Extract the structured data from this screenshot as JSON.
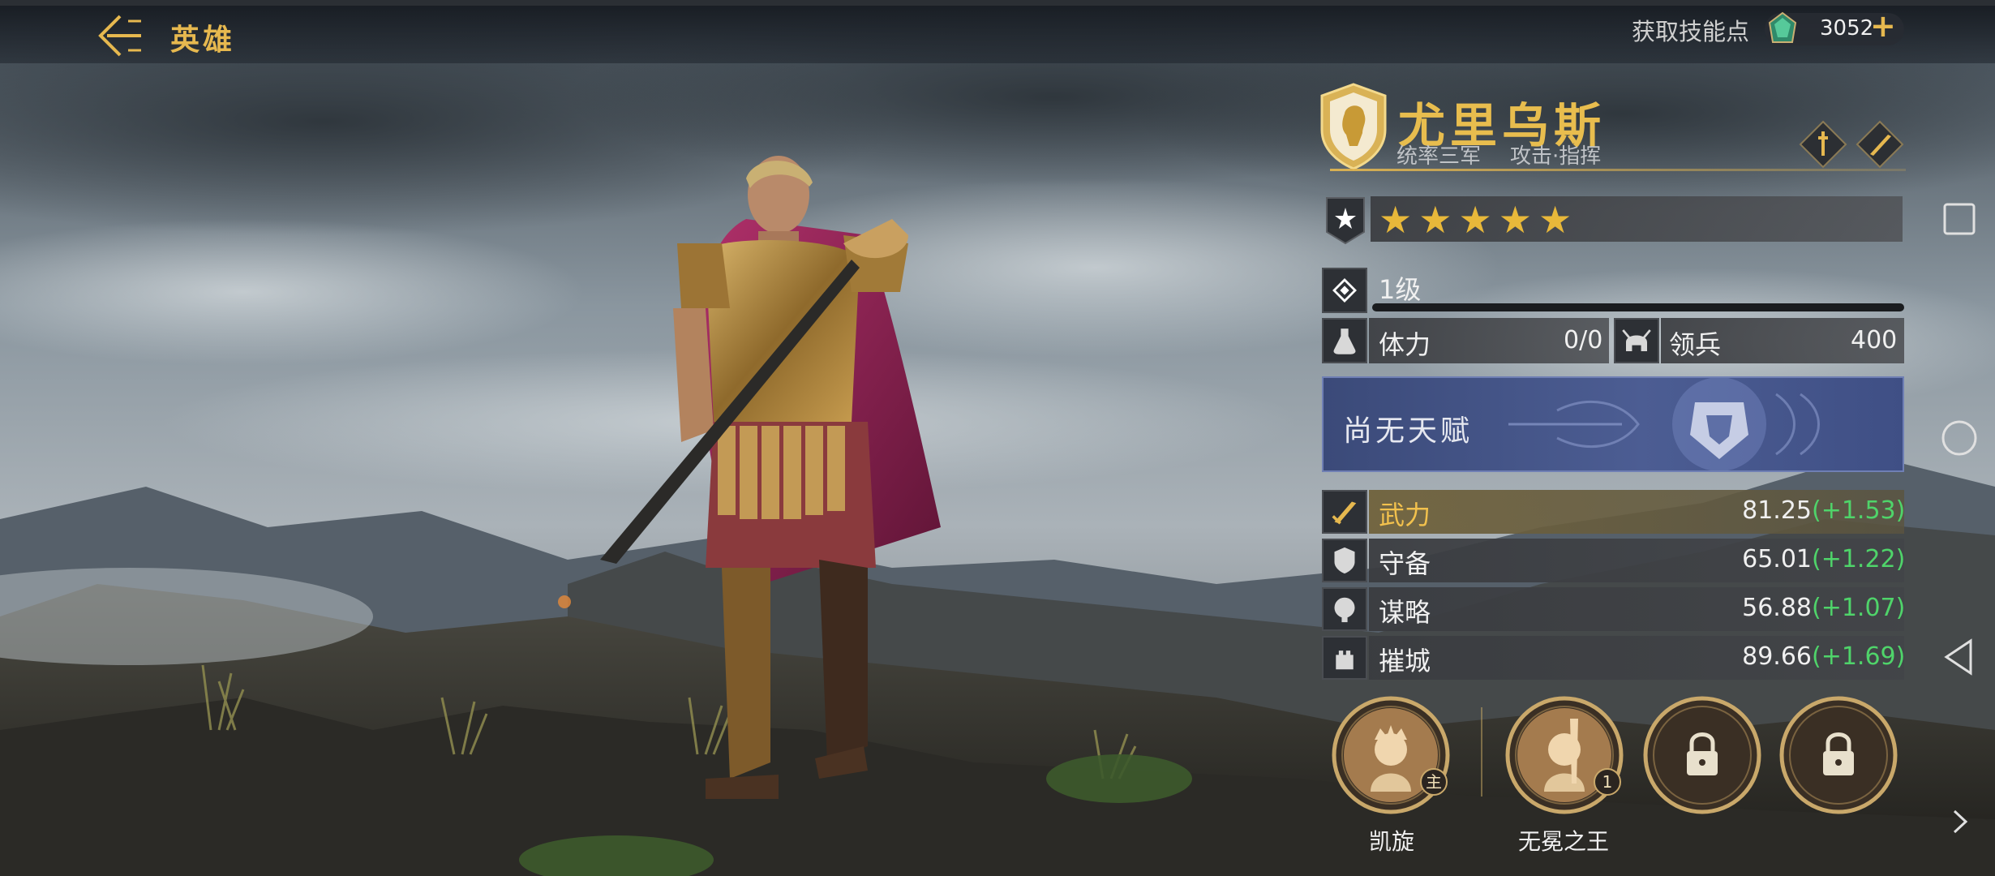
{
  "header": {
    "title": "英雄",
    "skill_points_label": "获取技能点",
    "skill_points_value": "3052",
    "plus": "+"
  },
  "hero": {
    "name": "尤里乌斯",
    "subtitle_role": "统率三军",
    "subtitle_type": "攻击·指挥",
    "stars": "★★★★★",
    "star_count": 5,
    "level": "1级",
    "level_progress": 0.0,
    "stamina_label": "体力",
    "stamina_value": "0/0",
    "troops_label": "领兵",
    "troops_value": "400",
    "talent": "尚无天赋"
  },
  "attributes": [
    {
      "label": "武力",
      "value": "81.25",
      "bonus": "(+1.53)",
      "icon": "sword-icon"
    },
    {
      "label": "守备",
      "value": "65.01",
      "bonus": "(+1.22)",
      "icon": "shield-icon"
    },
    {
      "label": "谋略",
      "value": "56.88",
      "bonus": "(+1.07)",
      "icon": "brain-icon"
    },
    {
      "label": "摧城",
      "value": "89.66",
      "bonus": "(+1.69)",
      "icon": "siege-icon"
    }
  ],
  "skills": [
    {
      "name": "凯旋",
      "badge": "主",
      "state": "unlocked"
    },
    {
      "name": "无冕之王",
      "badge": "1",
      "state": "unlocked"
    },
    {
      "name": "",
      "badge": "",
      "state": "locked"
    },
    {
      "name": "",
      "badge": "",
      "state": "locked"
    }
  ],
  "colors": {
    "gold": "#e6b84f",
    "bonus_green": "#4fd46a",
    "talent_blue": "#4c5d93"
  }
}
